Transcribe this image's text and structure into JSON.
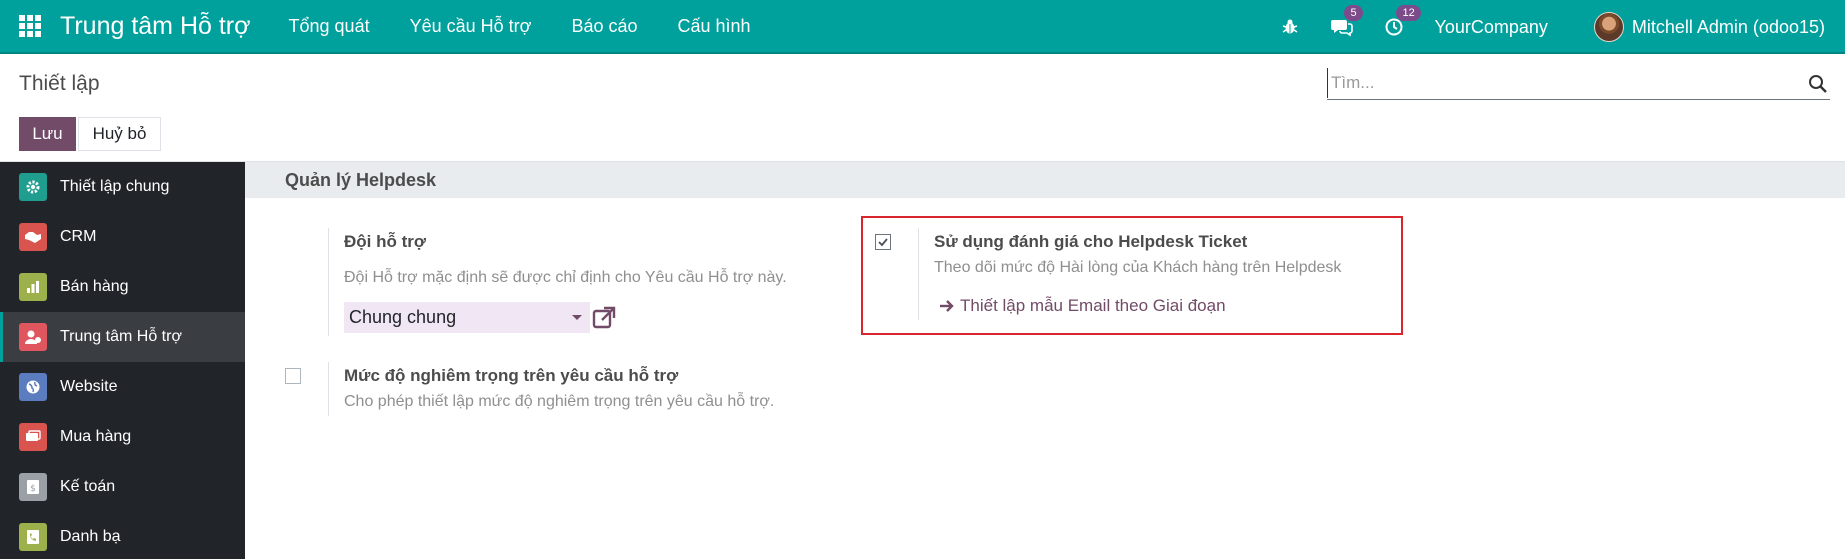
{
  "navbar": {
    "app_title": "Trung tâm Hỗ trợ",
    "menu": [
      "Tổng quát",
      "Yêu cầu Hỗ trợ",
      "Báo cáo",
      "Cấu hình"
    ],
    "messages_count": "5",
    "activities_count": "12",
    "company": "YourCompany",
    "user": "Mitchell Admin (odoo15)"
  },
  "control_panel": {
    "title": "Thiết lập",
    "search_placeholder": "Tìm...",
    "save_label": "Lưu",
    "cancel_label": "Huỷ bỏ"
  },
  "sidebar": {
    "items": [
      {
        "label": "Thiết lập chung",
        "icon": "gear-icon",
        "color": "#1f9d8f"
      },
      {
        "label": "CRM",
        "icon": "handshake-icon",
        "color": "#d9534f"
      },
      {
        "label": "Bán hàng",
        "icon": "chart-icon",
        "color": "#9cb04c"
      },
      {
        "label": "Trung tâm Hỗ trợ",
        "icon": "helpdesk-icon",
        "color": "#e0565e"
      },
      {
        "label": "Website",
        "icon": "globe-icon",
        "color": "#5b7cbf"
      },
      {
        "label": "Mua hàng",
        "icon": "cart-icon",
        "color": "#d9534f"
      },
      {
        "label": "Kế toán",
        "icon": "invoice-icon",
        "color": "#9aa0a6"
      },
      {
        "label": "Danh bạ",
        "icon": "contacts-icon",
        "color": "#9cb04c"
      }
    ]
  },
  "main": {
    "section_title": "Quản lý Helpdesk",
    "team": {
      "title": "Đội hỗ trợ",
      "description": "Đội Hỗ trợ mặc định sẽ được chỉ định cho Yêu cầu Hỗ trợ này.",
      "selected": "Chung chung"
    },
    "rating": {
      "title": "Sử dụng đánh giá cho Helpdesk Ticket",
      "description": "Theo dõi mức độ Hài lòng của Khách hàng trên Helpdesk",
      "link": "Thiết lập mẫu Email theo Giai đoạn",
      "checked": true
    },
    "priority": {
      "title": "Mức độ nghiêm trọng trên yêu cầu hỗ trợ",
      "description": "Cho phép thiết lập mức độ nghiêm trọng trên yêu cầu hỗ trợ.",
      "checked": false
    }
  },
  "colors": {
    "navbar": "#00a09d",
    "primary": "#714b67",
    "highlight": "#d9262e"
  }
}
